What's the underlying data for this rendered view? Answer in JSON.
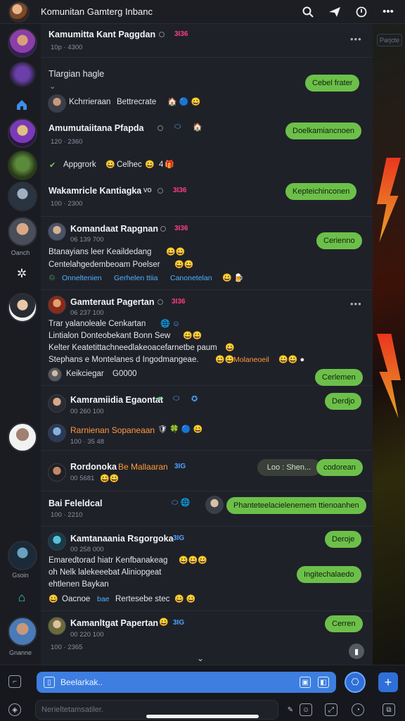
{
  "header": {
    "title": "Komunitan Gamterg Inbanc",
    "icons": [
      "search-icon",
      "send-icon",
      "info-icon",
      "more-icon"
    ]
  },
  "rail": {
    "labels": [
      "Oanch",
      "Gsoin",
      "Gnanne"
    ]
  },
  "art": {
    "ghost_label": "Parjcte"
  },
  "feed": {
    "items": [
      {
        "name": "Kamumitta Kant Paggdan",
        "tag": "3I36",
        "meta": "10p · 4300"
      },
      {
        "name": "Tlargian hagle",
        "reply_author": "Kchrrieraan",
        "reply_text": "Bettrecrate",
        "pill": "Cebel frater"
      },
      {
        "name": "Amumutaiitana Pfapda",
        "meta": "120 · 2360",
        "pill": "Doelkamiancnoen"
      },
      {
        "name": "Appgrork",
        "text": "Celhec",
        "count": "4"
      },
      {
        "name": "Wakamricle Kantiagka",
        "sub": "vo",
        "tag": "3I36",
        "meta": "100 · 2300",
        "pill": "Kepteichinconen"
      },
      {
        "name": "Komandaat Rapgnan",
        "tag": "3I36",
        "meta": "06 139 700",
        "lines": [
          "Btanayians leer Keaildedang",
          "Centelahgedembeoam Poelser"
        ],
        "links": [
          "Onneltenien",
          "Gerhelen ttiia",
          "Canonetelan"
        ],
        "pill": "Cerienno"
      },
      {
        "name": "Gamteraut Pagertan",
        "tag": "3I36",
        "meta": "06 237 100",
        "lines": [
          "Trar yalanoleale Cenkartan",
          "Lintialon Donteobekant Bonn Sew",
          "Kelter Keatetittachneedlakeoacefarnetbe paum",
          "Stephans e  Montelanes d Ingodmangeae."
        ],
        "extra_link": "Molaneoeil",
        "reply_author": "Keikciegar",
        "reply_text": "G0000",
        "pill": "Cerlemen"
      },
      {
        "name": "Kamramiidia Egaontat",
        "meta": "00 260 100",
        "pill": "Derdjo"
      },
      {
        "name": "Rarnienan Sopaneaan",
        "meta": "100 · 35 48"
      },
      {
        "name": "Rordonoka",
        "highlight": "Be Mallaaran",
        "tag": "3IG",
        "meta": "00 5681",
        "pill_gray": "Loo : Shen...",
        "pill": "codorean"
      },
      {
        "name": "Bai Feleldcal",
        "pill": "Phanteteelacielenemem ttienoanhen",
        "meta": "100 · 2210"
      },
      {
        "name": "Kamtanaania Rsgorgoka",
        "tag": "3IG",
        "meta": "00 258 000",
        "lines": [
          "Emaredtorad hiatr Kenfbanakeag",
          "oh Nelk lalekeeebat Aliniopgeat",
          "ehtlenen Baykan"
        ],
        "footer": "Oacnoe",
        "footer_link": "bae",
        "footer_text": "Rertesebe stec",
        "pill": "Deroje",
        "pill2": "Ingitechalaedo"
      },
      {
        "name": "Kamanltgat Papertan",
        "tag": "3IG",
        "meta": "00 220 100",
        "meta2": "100 · 2365",
        "pill": "Cerren"
      }
    ]
  },
  "composer": {
    "placeholder": "Beelarkak..",
    "placeholder2": "Nerieltetamsatiler."
  },
  "colors": {
    "accent": "#6cc04a",
    "brand_blue": "#3d7ee0",
    "tag_pink": "#ff3d7f"
  }
}
